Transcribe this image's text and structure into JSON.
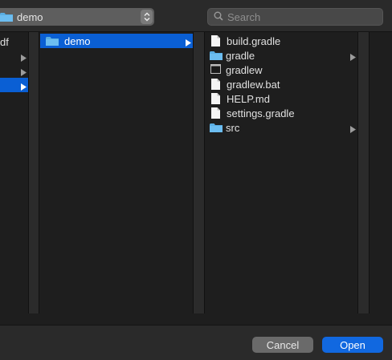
{
  "toolbar": {
    "location": "demo",
    "search_placeholder": "Search"
  },
  "columns": {
    "col1": {
      "items": [
        {
          "label": "df",
          "has_children": false,
          "selected": false
        },
        {
          "label": "",
          "has_children": true,
          "selected": false
        },
        {
          "label": "",
          "has_children": true,
          "selected": false
        },
        {
          "label": "",
          "has_children": true,
          "selected": true
        }
      ]
    },
    "col2": {
      "items": [
        {
          "label": "demo",
          "kind": "folder",
          "has_children": true,
          "selected": true
        }
      ]
    },
    "col3": {
      "items": [
        {
          "label": "build.gradle",
          "kind": "file",
          "has_children": false
        },
        {
          "label": "gradle",
          "kind": "folder",
          "has_children": true
        },
        {
          "label": "gradlew",
          "kind": "exec",
          "has_children": false
        },
        {
          "label": "gradlew.bat",
          "kind": "file",
          "has_children": false
        },
        {
          "label": "HELP.md",
          "kind": "file",
          "has_children": false
        },
        {
          "label": "settings.gradle",
          "kind": "file",
          "has_children": false
        },
        {
          "label": "src",
          "kind": "folder",
          "has_children": true
        }
      ]
    }
  },
  "footer": {
    "cancel_label": "Cancel",
    "open_label": "Open"
  },
  "colors": {
    "accent": "#0a5fd4",
    "folder": "#5aaee3",
    "background": "#1e1e1e"
  }
}
